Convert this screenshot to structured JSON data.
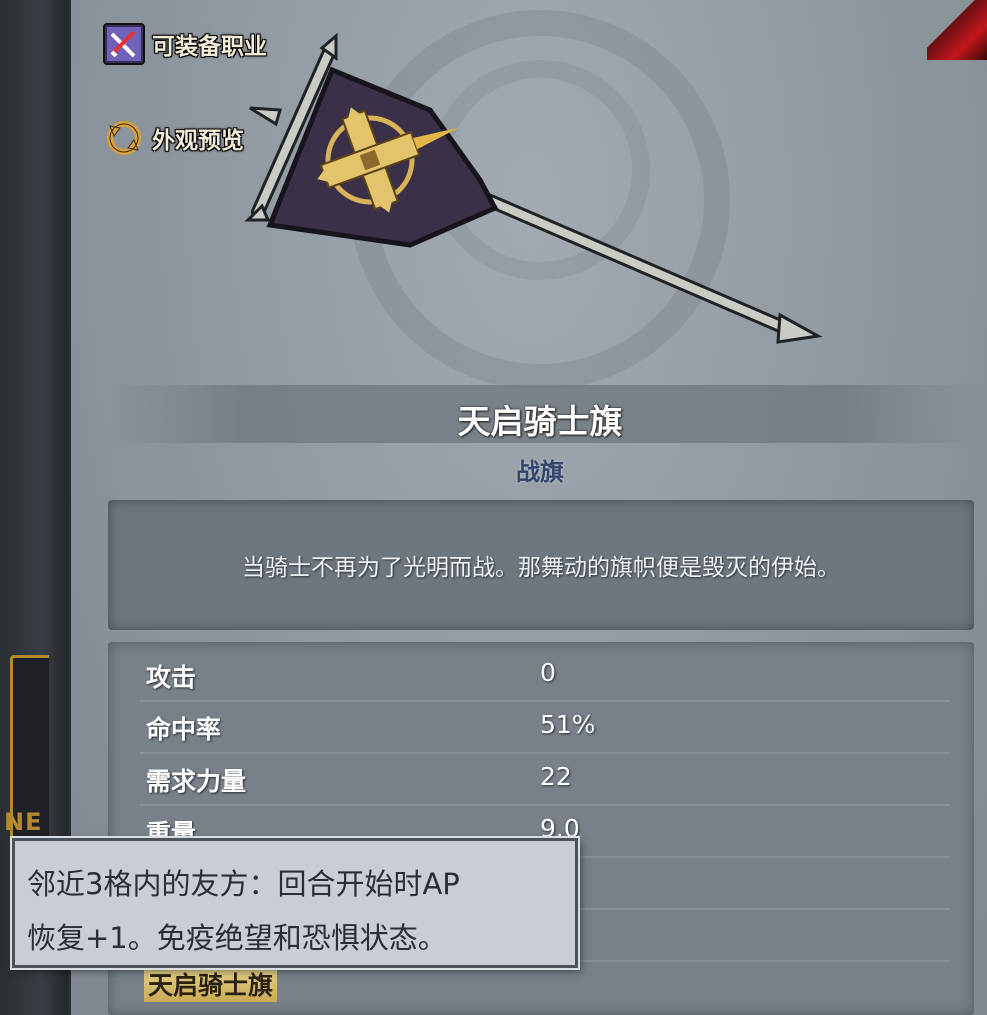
{
  "side_buttons": {
    "equip_class": "可装备职业",
    "appearance_preview": "外观预览"
  },
  "left_panel": {
    "partial_label": "NE"
  },
  "item": {
    "name": "天启骑士旗",
    "type": "战旗",
    "description": "当骑士不再为了光明而战。那舞动的旗帜便是毁灭的伊始。"
  },
  "stats": [
    {
      "label": "攻击",
      "value": "0"
    },
    {
      "label": "命中率",
      "value": "51%"
    },
    {
      "label": "需求力量",
      "value": "22"
    },
    {
      "label": "重量",
      "value": "9.0"
    }
  ],
  "set_name": "天启骑士旗",
  "tooltip": {
    "line1": "邻近3格内的友方：回合开始时AP",
    "line2": "恢复+1。免疫绝望和恐惧状态。"
  },
  "colors": {
    "accent_gold": "#c9a955",
    "type_blue": "#31466a",
    "close_red": "#c0161b"
  }
}
